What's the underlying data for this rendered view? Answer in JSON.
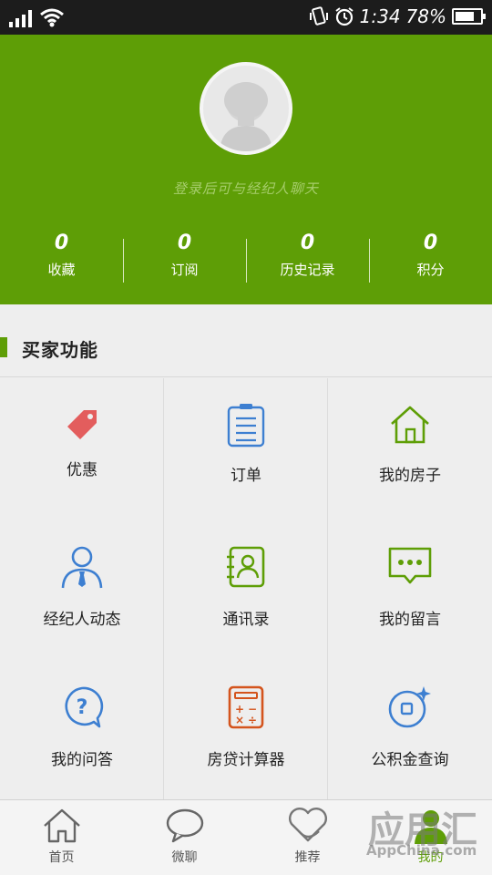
{
  "status_bar": {
    "time": "1:34",
    "battery": "78%",
    "battery_level": 0.78
  },
  "profile": {
    "login_hint": "登录后可与经纪人聊天",
    "stats": [
      {
        "value": "0",
        "label": "收藏"
      },
      {
        "value": "0",
        "label": "订阅"
      },
      {
        "value": "0",
        "label": "历史记录"
      },
      {
        "value": "0",
        "label": "积分"
      }
    ]
  },
  "section": {
    "title": "买家功能"
  },
  "features": [
    {
      "label": "优惠",
      "icon": "tag-icon",
      "color": "#e35d5d"
    },
    {
      "label": "订单",
      "icon": "clipboard-icon",
      "color": "#3d7fd1"
    },
    {
      "label": "我的房子",
      "icon": "house-icon",
      "color": "#5e9e06"
    },
    {
      "label": "经纪人动态",
      "icon": "agent-icon",
      "color": "#3d7fd1"
    },
    {
      "label": "通讯录",
      "icon": "contacts-icon",
      "color": "#5e9e06"
    },
    {
      "label": "我的留言",
      "icon": "message-icon",
      "color": "#5e9e06"
    },
    {
      "label": "我的问答",
      "icon": "question-icon",
      "color": "#3d7fd1"
    },
    {
      "label": "房贷计算器",
      "icon": "calculator-icon",
      "color": "#d4541d"
    },
    {
      "label": "公积金查询",
      "icon": "fund-query-icon",
      "color": "#3d7fd1"
    }
  ],
  "tabbar": [
    {
      "label": "首页",
      "icon": "home-icon"
    },
    {
      "label": "微聊",
      "icon": "chat-icon"
    },
    {
      "label": "推荐",
      "icon": "recommend-icon"
    },
    {
      "label": "我的",
      "icon": "person-icon"
    }
  ],
  "watermark": {
    "text": "应用汇",
    "sub": "AppChina.com"
  },
  "colors": {
    "brand_green": "#5e9e06",
    "status_bar_bg": "#1c1c1c",
    "accent_blue": "#3d7fd1"
  }
}
